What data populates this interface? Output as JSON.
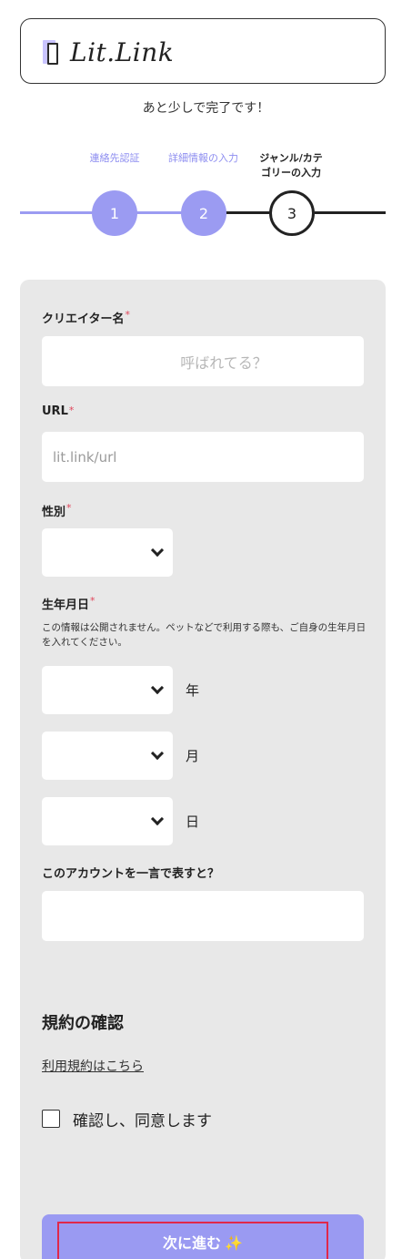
{
  "header": {
    "logo_text": "Lit.Link",
    "logo_mark_colors": {
      "back": "#c9c4ff",
      "front": "#2a2a2a"
    }
  },
  "page": {
    "subtitle": "あと少しで完了です！"
  },
  "steps": [
    {
      "label": "連絡先認証",
      "number": "1",
      "state": "done"
    },
    {
      "label": "詳細情報の入力",
      "number": "2",
      "state": "done"
    },
    {
      "label_line1": "ジャンル/カテ",
      "label_line2": "ゴリーの入力",
      "number": "3",
      "state": "current"
    }
  ],
  "form": {
    "creator_name": {
      "label": "クリエイター名",
      "required_mark": "*",
      "placeholder": "呼ばれてる？"
    },
    "url": {
      "label": "URL",
      "required_mark": "*",
      "placeholder": "lit.link/url"
    },
    "gender": {
      "label": "性別",
      "required_mark": "*"
    },
    "birthday": {
      "label": "生年月日",
      "required_mark": "*",
      "note": "この情報は公開されません。ペットなどで利用する際も、ご自身の生年月日を入れてください。",
      "year_unit": "年",
      "month_unit": "月",
      "day_unit": "日"
    },
    "tagline": {
      "label": "このアカウントを一言で表すと？"
    },
    "terms": {
      "title": "規約の確認",
      "link_text": "利用規約はこちら",
      "agree_label": "確認し、同意します"
    },
    "next_button": {
      "label": "次に進む",
      "icon": "✨"
    }
  },
  "colors": {
    "accent": "#9a9af2",
    "required": "#e0455a",
    "card_bg": "#e8e8e8",
    "highlight_border": "#e0284a"
  }
}
